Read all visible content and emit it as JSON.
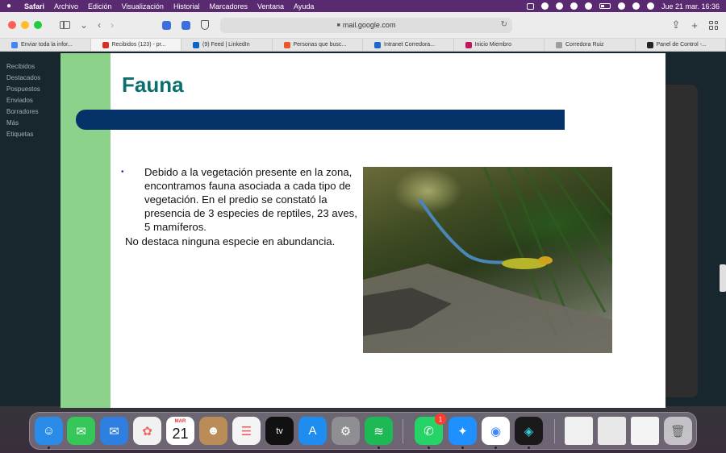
{
  "menubar": {
    "app": "Safari",
    "items": [
      "Archivo",
      "Edición",
      "Visualización",
      "Historial",
      "Marcadores",
      "Ventana",
      "Ayuda"
    ],
    "datetime": "Jue 21 mar.  16:36"
  },
  "toolbar": {
    "url": "mail.google.com"
  },
  "tabs": [
    {
      "label": "Enviar toda la infor...",
      "color": "#4285f4"
    },
    {
      "label": "Recibidos (123) - pr...",
      "color": "#d93025"
    },
    {
      "label": "(9) Feed | LinkedIn",
      "color": "#0a66c2"
    },
    {
      "label": "Personas que busc...",
      "color": "#e8562a"
    },
    {
      "label": "Intranet Corredora...",
      "color": "#1e66c9"
    },
    {
      "label": "Inicio Miembro",
      "color": "#c2185b"
    },
    {
      "label": "Corredora Ruiz",
      "color": "#9e9e9e"
    },
    {
      "label": "Panel de Control -...",
      "color": "#222222"
    }
  ],
  "gmail": {
    "left_items": [
      "Recibidos",
      "Destacados",
      "Pospuestos",
      "Enviados",
      "Borradores",
      "Más",
      "",
      "Etiquetas"
    ]
  },
  "slide": {
    "title": "Fauna",
    "bullet": "Debido a la vegetación presente en la zona, encontramos fauna asociada a cada tipo de vegetación. En el predio se constató la presencia de 3 especies de reptiles, 23 aves, 5 mamíferos.",
    "note": "No destaca ninguna especie en abundancia.",
    "bullet_symbol": "•"
  },
  "dock": {
    "calendar_month": "MAR",
    "calendar_day": "21",
    "whatsapp_badge": "1",
    "appletv_label": "tv"
  }
}
